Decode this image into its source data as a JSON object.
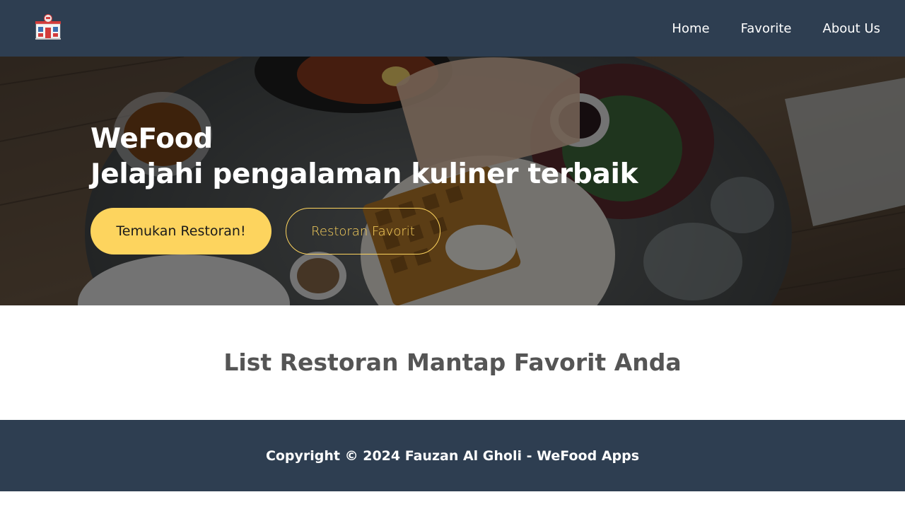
{
  "header": {
    "logo_icon": "restaurant-storefront-icon",
    "nav": [
      {
        "label": "Home"
      },
      {
        "label": "Favorite"
      },
      {
        "label": "About Us"
      }
    ]
  },
  "hero": {
    "title_line1": "WeFood",
    "title_line2": "Jelajahi pengalaman kuliner terbaik",
    "primary_button": "Temukan Restoran!",
    "secondary_button": "Restoran Favorit"
  },
  "main": {
    "title": "List Restoran Mantap Favorit Anda"
  },
  "footer": {
    "copyright": "Copyright © 2024 Fauzan Al Gholi - WeFood Apps"
  },
  "colors": {
    "navbar": "#2e3e51",
    "accent": "#fdd45e",
    "heading": "#555555"
  }
}
